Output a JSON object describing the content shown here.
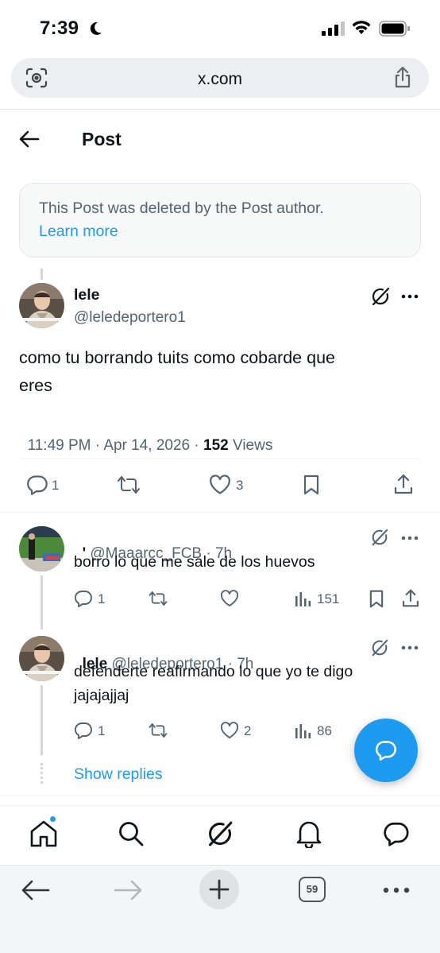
{
  "status_bar": {
    "time": "7:39"
  },
  "browser": {
    "url": "x.com",
    "tab_count": "59"
  },
  "header": {
    "title": "Post"
  },
  "notice": {
    "text": "This Post was deleted by the Post author.",
    "link": "Learn more"
  },
  "main_post": {
    "name": "lele",
    "handle": "@leledeportero1",
    "text_line1": "como tu borrando tuits como cobarde que",
    "text_line2": "eres",
    "time": "11:49 PM · Apr 14, 2026 · ",
    "views_count": "152",
    "views_label": " Views",
    "replies": "1",
    "likes": "3"
  },
  "replies": [
    {
      "name": "'",
      "handle": "@Maaarcc_FCB · 7h",
      "text": "borro lo que me sale de los huevos",
      "replies": "1",
      "views": "151"
    },
    {
      "name": "lele",
      "handle": "@leledeportero1 · 7h",
      "text_line1": "defenderte reafirmando lo que yo te digo",
      "text_line2": "jajajajjaj",
      "replies": "1",
      "likes": "2",
      "views": "86"
    }
  ],
  "show_replies": "Show replies",
  "colors": {
    "accent": "#1d9bf0",
    "text": "#0f1419",
    "secondary": "#536471"
  }
}
